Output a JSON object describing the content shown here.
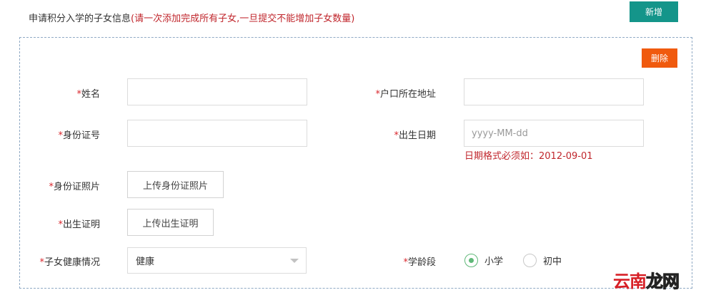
{
  "header": {
    "title": "申请积分入学的子女信息",
    "note": "(请一次添加完成所有子女,一旦提交不能增加子女数量)",
    "add_button": "新增"
  },
  "panel": {
    "delete_button": "删除",
    "required_mark": "*",
    "fields": {
      "name": {
        "label": "姓名",
        "value": ""
      },
      "hukou": {
        "label": "户口所在地址",
        "value": ""
      },
      "id_number": {
        "label": "身份证号",
        "value": ""
      },
      "birth_date": {
        "label": "出生日期",
        "value": "",
        "placeholder": "yyyy-MM-dd",
        "hint": "日期格式必须如：2012-09-01"
      },
      "id_photo": {
        "label": "身份证照片",
        "button": "上传身份证照片"
      },
      "birth_cert": {
        "label": "出生证明",
        "button": "上传出生证明"
      },
      "health": {
        "label": "子女健康情况",
        "selected": "健康"
      },
      "school_stage": {
        "label": "学龄段",
        "options": [
          {
            "label": "小学",
            "selected": true
          },
          {
            "label": "初中",
            "selected": false
          }
        ]
      }
    }
  },
  "watermark": {
    "part1": "云南",
    "part2": "龙网"
  },
  "colors": {
    "add_button": "#14958a",
    "delete_button": "#f05a0e",
    "required": "#d9262c",
    "note": "#c0262c",
    "radio_active": "#5fb878"
  }
}
